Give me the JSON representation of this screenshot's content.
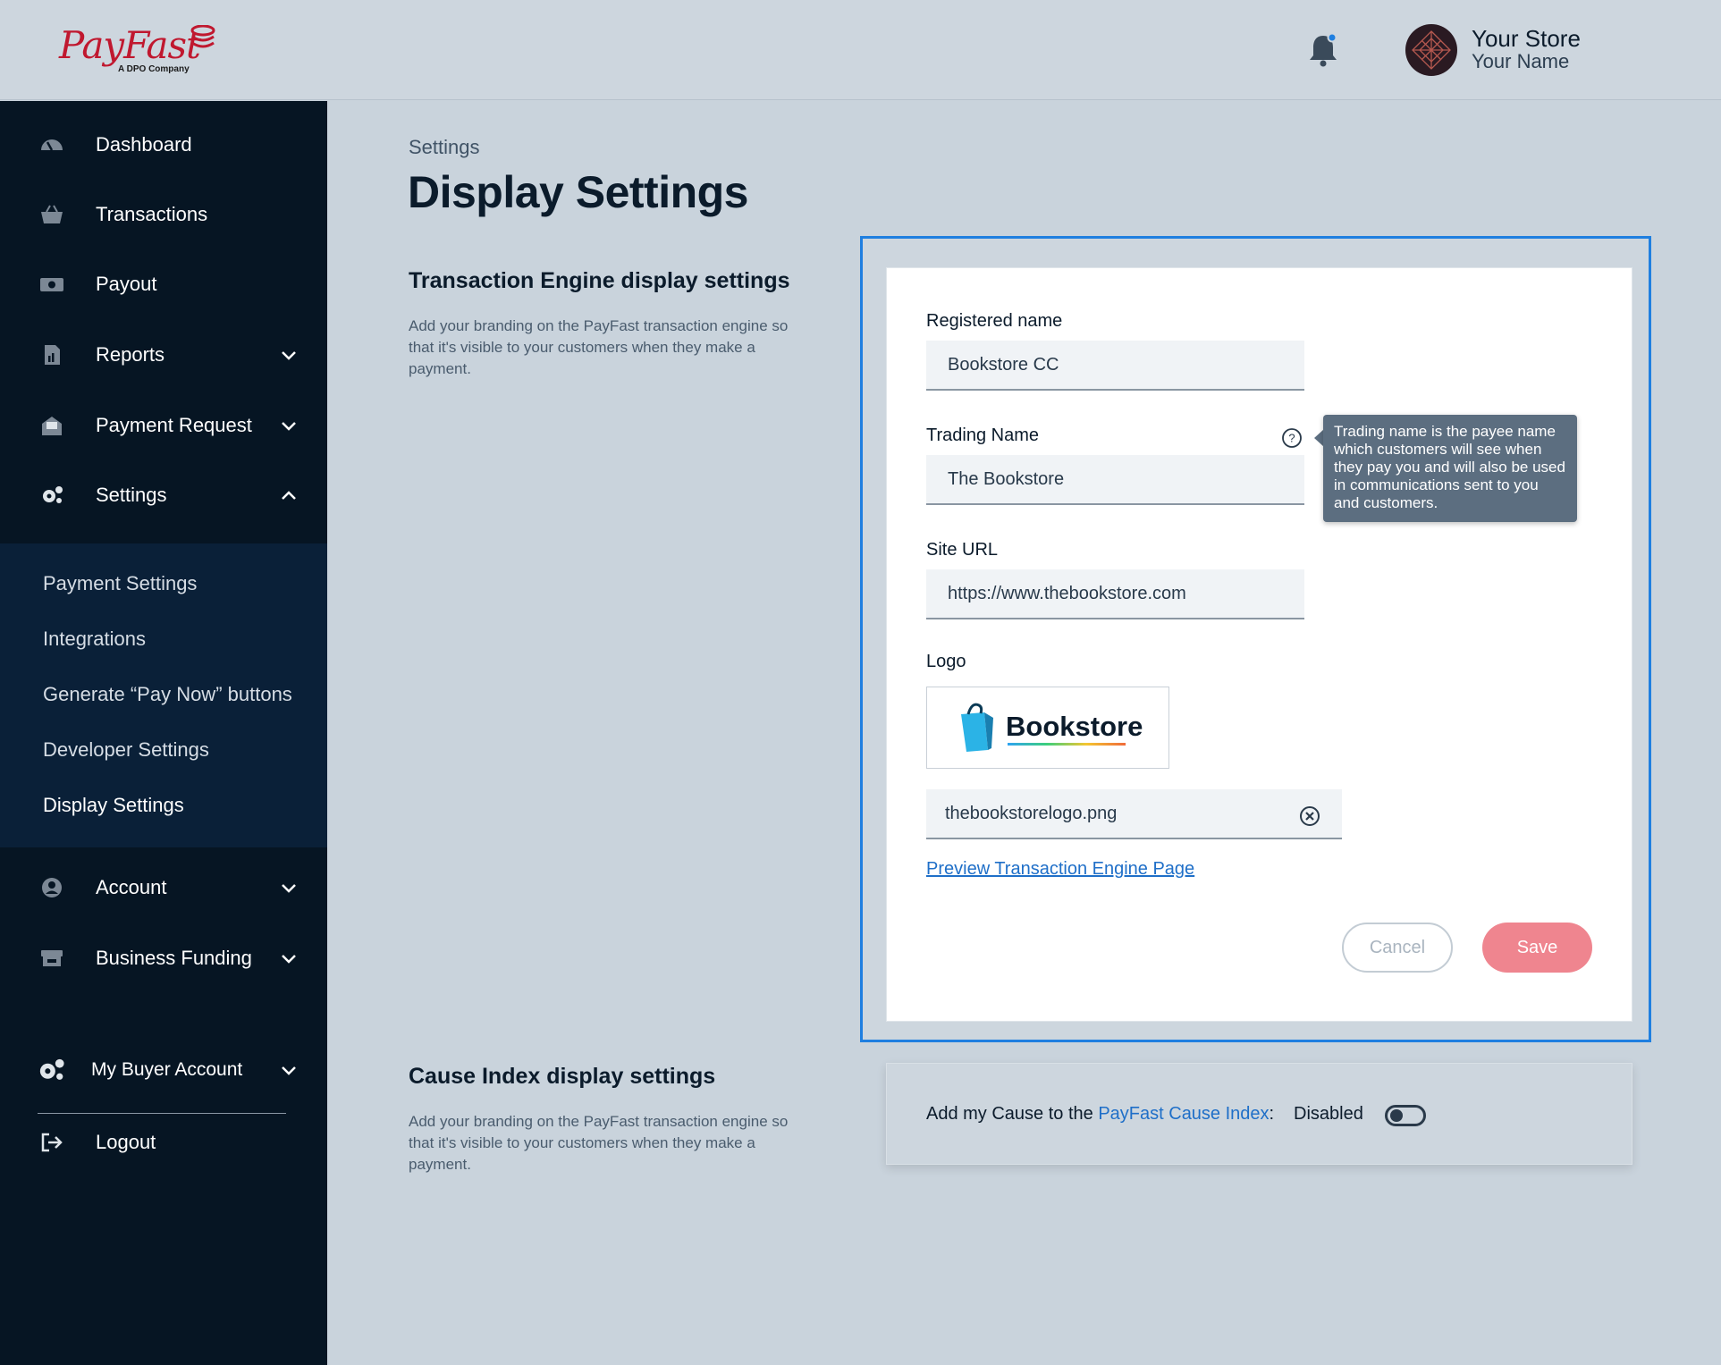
{
  "header": {
    "logo_text": "PayFast",
    "logo_subtitle": "A DPO Company",
    "store_name": "Your Store",
    "user_name": "Your Name",
    "notification_icon": "bell-icon"
  },
  "sidebar": {
    "items": [
      {
        "label": "Dashboard",
        "icon": "dashboard-gauge-icon"
      },
      {
        "label": "Transactions",
        "icon": "basket-icon"
      },
      {
        "label": "Payout",
        "icon": "cash-icon"
      },
      {
        "label": "Reports",
        "icon": "report-icon",
        "expandable": true
      },
      {
        "label": "Payment Request",
        "icon": "payment-request-icon",
        "expandable": true
      },
      {
        "label": "Settings",
        "icon": "gears-icon",
        "expanded": true
      }
    ],
    "settings_submenu": [
      {
        "label": "Payment Settings"
      },
      {
        "label": "Integrations"
      },
      {
        "label": "Generate “Pay Now” buttons"
      },
      {
        "label": "Developer Settings"
      },
      {
        "label": "Display Settings",
        "active": true
      }
    ],
    "lower_items": [
      {
        "label": "Account",
        "icon": "user-icon"
      },
      {
        "label": "Business Funding",
        "icon": "store-icon"
      }
    ],
    "buyer_account": {
      "label": "My Buyer Account",
      "icon": "gears-icon"
    },
    "logout": {
      "label": "Logout",
      "icon": "logout-icon"
    }
  },
  "main": {
    "breadcrumb": "Settings",
    "title": "Display Settings",
    "transaction_section": {
      "title": "Transaction Engine display settings",
      "description": "Add your branding on the PayFast transaction engine so that it's visible to your customers when they make a payment."
    },
    "form": {
      "registered_name_label": "Registered name",
      "registered_name_value": "Bookstore CC",
      "trading_name_label": "Trading Name",
      "trading_name_value": "The Bookstore",
      "trading_name_tooltip": "Trading name is the payee name which customers will see when they pay you and will also be used in communications sent to you and customers.",
      "site_url_label": "Site URL",
      "site_url_value": "https://www.thebookstore.com",
      "logo_label": "Logo",
      "logo_preview_text": "Bookstore",
      "logo_filename": "thebookstorelogo.png",
      "preview_link": "Preview Transaction Engine Page",
      "cancel_label": "Cancel",
      "save_label": "Save"
    },
    "cause_section": {
      "title": "Cause Index display settings",
      "description": "Add your branding on the PayFast transaction engine so that it's visible to your customers when they make a payment.",
      "text_prefix": "Add my Cause to the ",
      "link_text": "PayFast Cause Index",
      "text_suffix": ":",
      "status": "Disabled",
      "enabled": false
    }
  },
  "colors": {
    "brand_red": "#c0182f",
    "accent_blue": "#1f7fe0",
    "sidebar_bg": "#061523",
    "save_button": "#ef858f"
  }
}
